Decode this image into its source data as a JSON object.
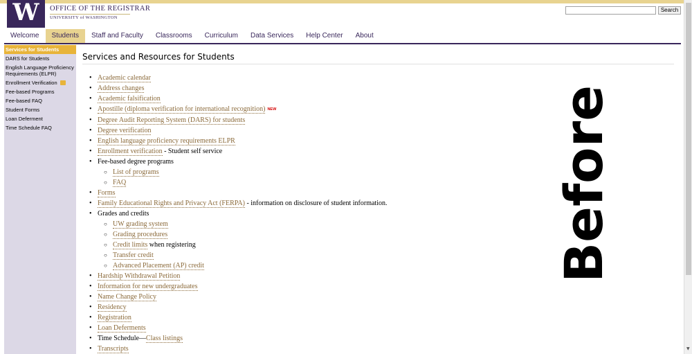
{
  "header": {
    "logo": "W",
    "title": "OFFICE OF THE REGISTRAR",
    "subtitle": "UNIVERSITY of WASHINGTON",
    "search_value": "",
    "search_button": "Search"
  },
  "nav": {
    "items": [
      "Welcome",
      "Students",
      "Staff and Faculty",
      "Classrooms",
      "Curriculum",
      "Data Services",
      "Help Center",
      "About"
    ],
    "active": "Students"
  },
  "sidebar": {
    "items": [
      "Services for Students",
      "DARS for Students",
      "English Language Proficiency Requirements (ELPR)",
      "Enrollment Verification",
      "Fee-based Programs",
      "Fee-based FAQ",
      "Student Forms",
      "Loan Deferment",
      "Time Schedule FAQ"
    ]
  },
  "main": {
    "title": "Services and Resources for Students",
    "items": [
      {
        "link": "Academic calendar"
      },
      {
        "link": "Address changes"
      },
      {
        "link": "Academic falsification"
      },
      {
        "link": "Apostille (diploma verification for international recognition)",
        "badge": "NEW"
      },
      {
        "link": "Degree Audit Reporting System (DARS) for students"
      },
      {
        "link": "Degree verification"
      },
      {
        "link": "English language proficiency requirements ELPR"
      },
      {
        "link": "Enrollment verification",
        "suffix": " - Student self service"
      },
      {
        "text": "Fee-based degree programs"
      },
      {
        "link": "List of programs",
        "sub": true
      },
      {
        "link": "FAQ",
        "sub": true
      },
      {
        "link": "Forms"
      },
      {
        "link": "Family Educational Rights and Privacy Act (FERPA)",
        "suffix": " - information on disclosure of student information."
      },
      {
        "text": "Grades and credits"
      },
      {
        "link": "UW grading system",
        "sub": true
      },
      {
        "link": "Grading procedures",
        "sub": true
      },
      {
        "link": "Credit limits",
        "suffix": " when registering",
        "sub": true
      },
      {
        "link": "Transfer credit",
        "sub": true
      },
      {
        "link": "Advanced Placement (AP) credit",
        "sub": true
      },
      {
        "link": "Hardship Withdrawal Petition"
      },
      {
        "link": "Information for new undergraduates"
      },
      {
        "link": "Name Change Policy"
      },
      {
        "link": "Residency"
      },
      {
        "link": "Registration"
      },
      {
        "link": "Loan Deferments"
      },
      {
        "text": "Time Schedule—",
        "link2": "Class listings"
      },
      {
        "link": "Transcripts"
      }
    ]
  },
  "overlay": {
    "label": "Before"
  }
}
